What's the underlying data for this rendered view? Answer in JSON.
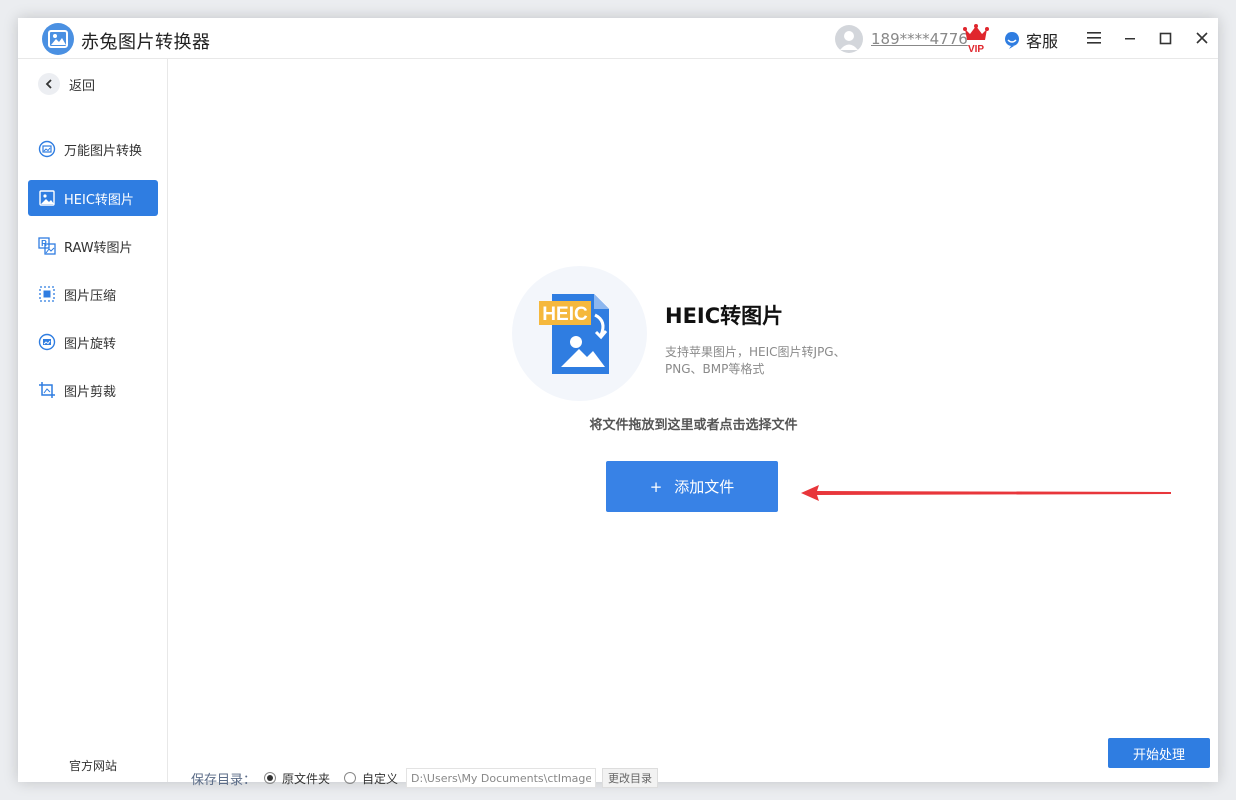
{
  "app": {
    "title": "赤兔图片转换器"
  },
  "header": {
    "username": "189****4776",
    "vip_badge": "VIP",
    "service_label": "客服"
  },
  "sidebar": {
    "back_label": "返回",
    "items": [
      {
        "label": "万能图片转换",
        "icon": "image-convert-icon",
        "active": false
      },
      {
        "label": "HEIC转图片",
        "icon": "heic-icon",
        "active": true
      },
      {
        "label": "RAW转图片",
        "icon": "raw-icon",
        "active": false
      },
      {
        "label": "图片压缩",
        "icon": "compress-icon",
        "active": false
      },
      {
        "label": "图片旋转",
        "icon": "rotate-icon",
        "active": false
      },
      {
        "label": "图片剪裁",
        "icon": "crop-icon",
        "active": false
      }
    ],
    "official_site": "官方网站"
  },
  "main": {
    "hero_badge": "HEIC",
    "feature_title": "HEIC转图片",
    "feature_desc": "支持苹果图片，HEIC图片转JPG、PNG、BMP等格式",
    "drop_hint": "将文件拖放到这里或者点击选择文件",
    "add_plus": "+",
    "add_button": "添加文件"
  },
  "footer": {
    "save_label": "保存目录：",
    "option_original": "原文件夹",
    "option_custom": "自定义",
    "path_value": "D:\\Users\\My Documents\\ctImageC",
    "change_dir": "更改目录",
    "start_button": "开始处理"
  },
  "colors": {
    "accent": "#2f7de1",
    "add_button": "#3882e6",
    "arrow": "#e8363b",
    "heic_badge": "#f5b83d"
  }
}
